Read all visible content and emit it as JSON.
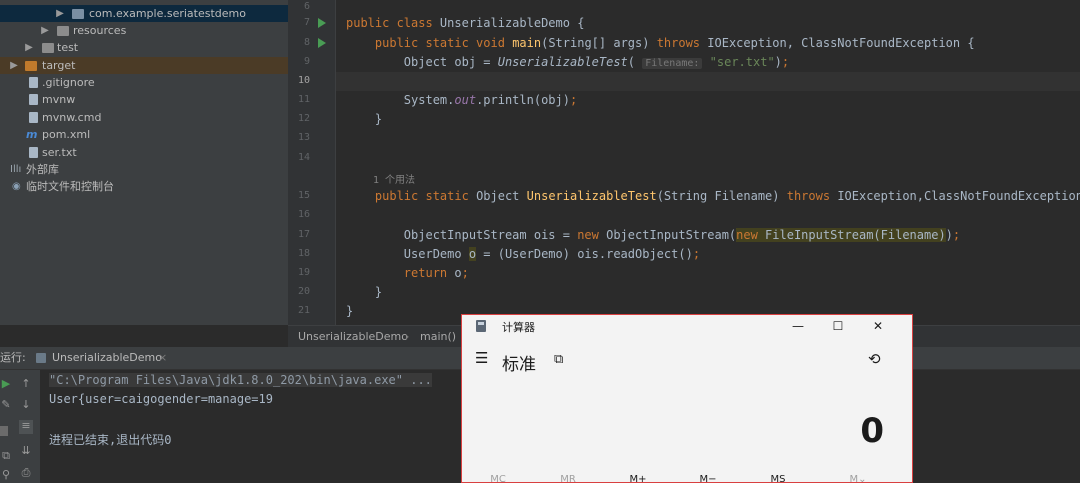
{
  "project_tree": {
    "items": [
      {
        "label": "com.example.seriatestdemo",
        "type": "package"
      },
      {
        "label": "resources",
        "type": "folder"
      },
      {
        "label": "test",
        "type": "folder"
      },
      {
        "label": "target",
        "type": "folder"
      },
      {
        "label": ".gitignore",
        "type": "file"
      },
      {
        "label": "mvnw",
        "type": "file"
      },
      {
        "label": "mvnw.cmd",
        "type": "file"
      },
      {
        "label": "pom.xml",
        "type": "file"
      },
      {
        "label": "ser.txt",
        "type": "file"
      },
      {
        "label": "外部库",
        "type": "library"
      },
      {
        "label": "临时文件和控制台",
        "type": "scratches"
      }
    ]
  },
  "editor": {
    "line_numbers": [
      "6",
      "7",
      "8",
      "9",
      "10",
      "11",
      "12",
      "13",
      "14",
      "15",
      "16",
      "17",
      "18",
      "19",
      "20",
      "21"
    ],
    "usages_hint": "1 个用法",
    "param_hint": "Filename:",
    "breadcrumb": {
      "class": "UnserializableDemo",
      "method": "main()"
    }
  },
  "run_panel": {
    "label": "运行:",
    "tab": "UnserializableDemo",
    "console_lines": [
      "\"C:\\Program Files\\Java\\jdk1.8.0_202\\bin\\java.exe\" ...",
      "User{user=caigogender=manage=19",
      "",
      "进程已结束,退出代码0"
    ]
  },
  "calculator": {
    "title": "计算器",
    "mode": "标准",
    "display": "0",
    "memory_buttons": [
      "MC",
      "MR",
      "M+",
      "M−",
      "MS",
      "M⌄"
    ],
    "icons": [
      "hamburger-icon",
      "keep-on-top-icon",
      "history-icon"
    ]
  },
  "colors": {
    "keyword": "#cc7832",
    "method": "#ffc66d",
    "string": "#6a8759",
    "text": "#a9b7c6",
    "calc_border": "#d94040"
  }
}
